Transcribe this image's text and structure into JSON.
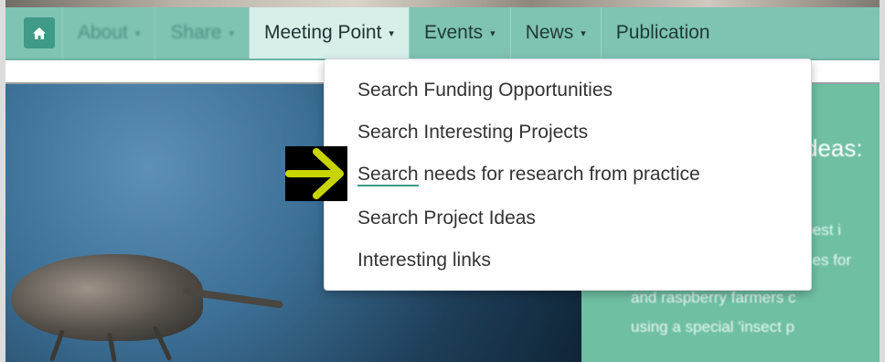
{
  "nav": {
    "home_label": "",
    "items": [
      {
        "label": "About",
        "caret": "▾"
      },
      {
        "label": "Share",
        "caret": "▾"
      },
      {
        "label": "Meeting Point",
        "caret": "▾"
      },
      {
        "label": "Events",
        "caret": "▾"
      },
      {
        "label": "News",
        "caret": "▾"
      },
      {
        "label": "Publication",
        "caret": ""
      }
    ]
  },
  "dropdown": {
    "items": [
      {
        "label": "Search Funding Opportunities"
      },
      {
        "label": "Search Interesting Projects"
      },
      {
        "label_part1": "Search",
        "label_part2": " needs for research from practice"
      },
      {
        "label": "Search Project Ideas"
      },
      {
        "label": "Interesting links"
      }
    ]
  },
  "side_panel": {
    "title_fragment": "deas:",
    "lines": [
      "t pest i",
      "ses for",
      "and raspberry farmers c",
      "using a special 'insect p"
    ]
  },
  "colors": {
    "navbar": "#7fc3b3",
    "active_tab": "#d7eee9",
    "home_button": "#3f9a86",
    "side_panel": "#6fbfa3",
    "arrow": "#c8d400",
    "underline": "#3a9b85"
  },
  "icons": {
    "home": "home-icon",
    "pointer": "arrow-right-icon"
  }
}
